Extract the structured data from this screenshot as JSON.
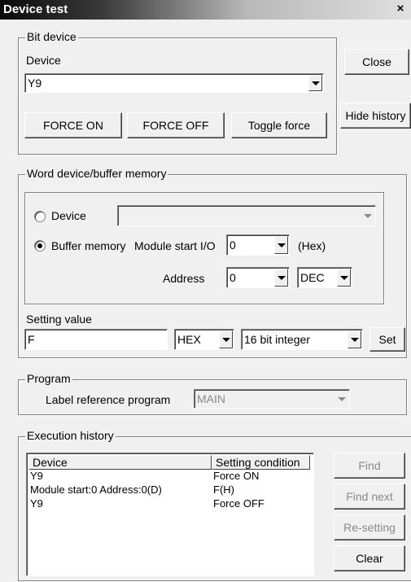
{
  "window": {
    "title": "Device test",
    "close_glyph": "×"
  },
  "bit_device": {
    "legend": "Bit device",
    "device_label": "Device",
    "device_value": "Y9",
    "force_on": "FORCE ON",
    "force_off": "FORCE OFF",
    "toggle_force": "Toggle force"
  },
  "side_buttons": {
    "close": "Close",
    "hide_history": "Hide history"
  },
  "word_device": {
    "legend": "Word device/buffer memory",
    "device_radio": "Device",
    "device_value": "",
    "buffer_radio": "Buffer memory",
    "module_start_label": "Module start I/O",
    "module_start_value": "0",
    "hex_label": "(Hex)",
    "address_label": "Address",
    "address_value": "0",
    "address_format": "DEC",
    "selected": "buffer"
  },
  "setting": {
    "label": "Setting value",
    "value": "F",
    "format": "HEX",
    "type": "16 bit integer",
    "set_button": "Set"
  },
  "program": {
    "legend": "Program",
    "label": "Label reference program",
    "value": "MAIN"
  },
  "history": {
    "legend": "Execution history",
    "columns": [
      "Device",
      "Setting condition"
    ],
    "rows": [
      {
        "device": "Y9",
        "condition": "Force ON"
      },
      {
        "device": "Module start:0 Address:0(D)",
        "condition": "F(H)"
      },
      {
        "device": "Y9",
        "condition": "Force OFF"
      }
    ],
    "buttons": {
      "find": "Find",
      "find_next": "Find next",
      "resetting": "Re-setting",
      "clear": "Clear"
    }
  },
  "icons": [
    "close-icon",
    "chevron-down-icon",
    "radio-icon"
  ]
}
